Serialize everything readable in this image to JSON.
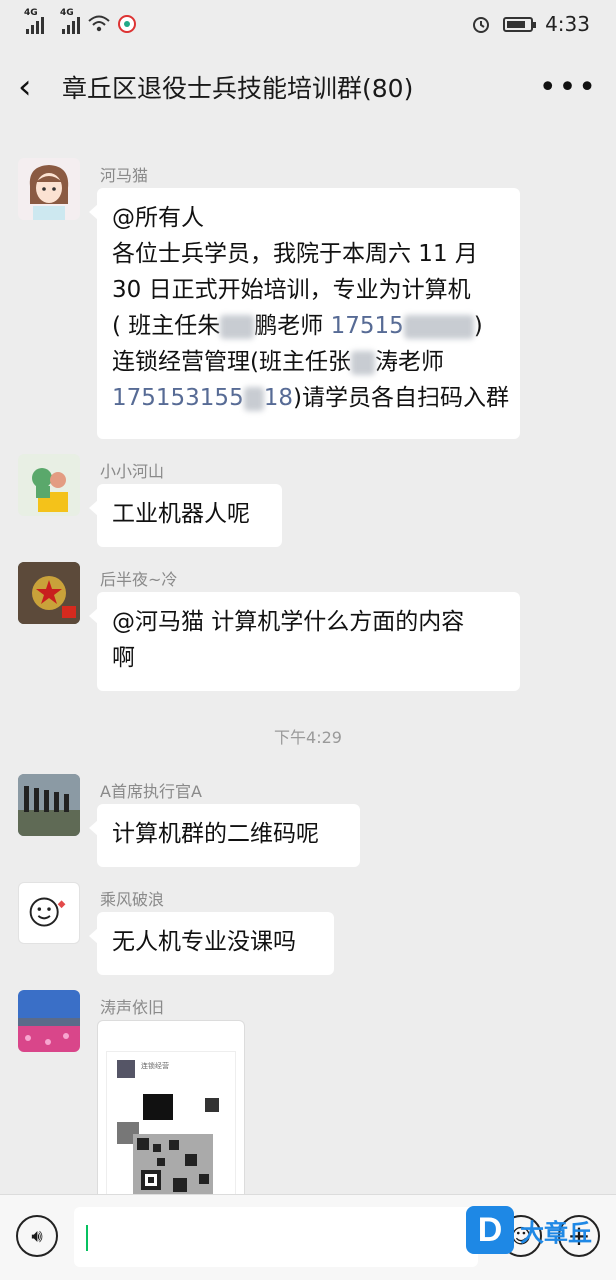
{
  "status_bar": {
    "network_1": "4G",
    "network_2": "4G",
    "time": "4:33",
    "battery_level": 0.8
  },
  "header": {
    "title": "章丘区退役士兵技能培训群(80)"
  },
  "chat": {
    "timestamps": [
      "下午4:29"
    ],
    "messages": [
      {
        "sender": "河马猫",
        "lines": [
          [
            "@所有人"
          ],
          [
            "各位士兵学员，我院于本周六 11 月"
          ],
          [
            "30 日正式开始培训，专业为计算机"
          ],
          [
            "( 班主任朱",
            "鹏老师 ",
            "17515",
            ")"
          ],
          [
            "连锁经营管理(班主任张",
            "涛老师"
          ],
          [
            "175153155",
            "18",
            ")请学员各自扫码入群"
          ]
        ]
      },
      {
        "sender": "小小河山",
        "text": "工业机器人呢"
      },
      {
        "sender": "后半夜~冷",
        "lines": [
          [
            "@河马猫  计算机学什么方面的内容"
          ],
          [
            "啊"
          ]
        ]
      },
      {
        "sender": "A首席执行官A",
        "text": "计算机群的二维码呢"
      },
      {
        "sender": "乘风破浪",
        "text": "无人机专业没课吗"
      },
      {
        "sender": "涛声依旧",
        "image_caption": "连锁经营"
      }
    ]
  },
  "watermark": {
    "logo": "D",
    "text": "大章丘"
  }
}
